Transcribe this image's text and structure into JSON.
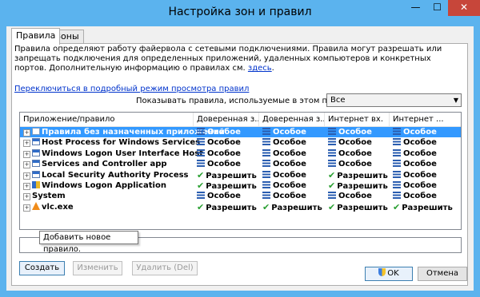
{
  "window": {
    "title": "Настройка зон и правил",
    "min_glyph": "—",
    "max_glyph": "☐",
    "close_glyph": "✕"
  },
  "tabs": [
    {
      "label": "Правила",
      "active": true
    },
    {
      "label": "Зоны",
      "active": false
    }
  ],
  "description": {
    "text": "Правила определяют работу файервола с сетевыми подключениями. Правила могут разрешать или запрещать подключения для определенных приложений, удаленных компьютеров и конкретных портов. Дополнительную информацию о правилах см.",
    "here_link": "здесь",
    "here_suffix": ".",
    "detailed_mode_link": "Переключиться в подробный режим просмотра правил"
  },
  "profile": {
    "label": "Показывать правила, используемые в этом профиле:",
    "selected": "Все"
  },
  "table": {
    "columns": [
      "Приложение/правило",
      "Доверенная з...",
      "Доверенная з...",
      "Интернет вх.",
      "Интернет ..."
    ],
    "rows": [
      {
        "name": "Правила без назначенных приложений",
        "icon": "rule-icon",
        "values": [
          "Особое",
          "Особое",
          "Особое",
          "Особое"
        ],
        "kinds": [
          "custom",
          "custom",
          "custom",
          "custom"
        ],
        "selected": true
      },
      {
        "name": "Host Process for Windows Services",
        "icon": "window-app-icon",
        "values": [
          "Особое",
          "Особое",
          "Особое",
          "Особое"
        ],
        "kinds": [
          "custom",
          "custom",
          "custom",
          "custom"
        ],
        "selected": false
      },
      {
        "name": "Windows Logon User Interface Host",
        "icon": "window-app-icon",
        "values": [
          "Особое",
          "Особое",
          "Особое",
          "Особое"
        ],
        "kinds": [
          "custom",
          "custom",
          "custom",
          "custom"
        ],
        "selected": false
      },
      {
        "name": "Services and Controller app",
        "icon": "window-app-icon",
        "values": [
          "Особое",
          "Особое",
          "Особое",
          "Особое"
        ],
        "kinds": [
          "custom",
          "custom",
          "custom",
          "custom"
        ],
        "selected": false
      },
      {
        "name": "Local Security Authority Process",
        "icon": "window-app-icon",
        "values": [
          "Разрешить",
          "Особое",
          "Разрешить",
          "Особое"
        ],
        "kinds": [
          "allow",
          "custom",
          "allow",
          "custom"
        ],
        "selected": false
      },
      {
        "name": "Windows Logon Application",
        "icon": "shield-app-icon",
        "values": [
          "Разрешить",
          "Особое",
          "Разрешить",
          "Особое"
        ],
        "kinds": [
          "allow",
          "custom",
          "allow",
          "custom"
        ],
        "selected": false
      },
      {
        "name": "System",
        "icon": "",
        "values": [
          "Особое",
          "Особое",
          "Особое",
          "Особое"
        ],
        "kinds": [
          "custom",
          "custom",
          "custom",
          "custom"
        ],
        "selected": false
      },
      {
        "name": "vlc.exe",
        "icon": "vlc-cone-icon",
        "values": [
          "Разрешить",
          "Разрешить",
          "Разрешить",
          "Разрешить"
        ],
        "kinds": [
          "allow",
          "allow",
          "allow",
          "allow"
        ],
        "selected": false
      }
    ]
  },
  "buttons": {
    "create": "Создать",
    "edit": "Изменить",
    "delete": "Удалить (Del)",
    "ok": "OK",
    "cancel": "Отмена"
  },
  "tooltip": "Добавить новое правило.",
  "colors": {
    "frame": "#5bb3ee",
    "selection": "#3399ff",
    "custom_icon": "#2a5db0",
    "allow_icon": "#2aa032",
    "link": "#0033cc",
    "close_button": "#c7463a"
  }
}
